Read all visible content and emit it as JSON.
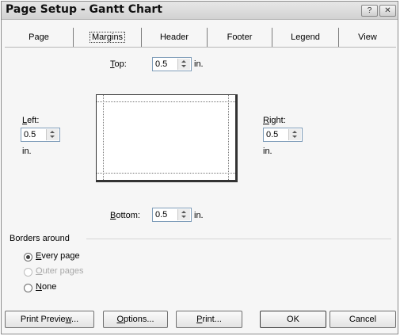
{
  "window": {
    "title": "Page Setup - Gantt Chart",
    "help_glyph": "?",
    "close_glyph": "✕"
  },
  "tabs": [
    {
      "label": "Page"
    },
    {
      "label": "Margins"
    },
    {
      "label": "Header"
    },
    {
      "label": "Footer"
    },
    {
      "label": "Legend"
    },
    {
      "label": "View"
    }
  ],
  "active_tab": "Margins",
  "margins": {
    "top": {
      "label_ul": "T",
      "label_rest": "op:",
      "value": "0.5",
      "unit": "in."
    },
    "left": {
      "label_ul": "L",
      "label_rest": "eft:",
      "value": "0.5",
      "unit": "in."
    },
    "right": {
      "label_ul": "R",
      "label_rest": "ight:",
      "value": "0.5",
      "unit": "in."
    },
    "bottom": {
      "label_ul": "B",
      "label_rest": "ottom:",
      "value": "0.5",
      "unit": "in."
    }
  },
  "borders": {
    "group_label": "Borders around",
    "options": [
      {
        "ul": "E",
        "rest": "very page",
        "checked": true,
        "disabled": false
      },
      {
        "ul": "O",
        "rest": "uter pages",
        "checked": false,
        "disabled": true
      },
      {
        "ul": "N",
        "rest": "one",
        "checked": false,
        "disabled": false
      }
    ]
  },
  "buttons": {
    "print_preview": {
      "pre": "Print Previe",
      "ul": "w",
      "post": "..."
    },
    "options": {
      "pre": "",
      "ul": "O",
      "post": "ptions..."
    },
    "print": {
      "pre": "",
      "ul": "P",
      "post": "rint..."
    },
    "ok": {
      "label": "OK"
    },
    "cancel": {
      "label": "Cancel"
    }
  }
}
